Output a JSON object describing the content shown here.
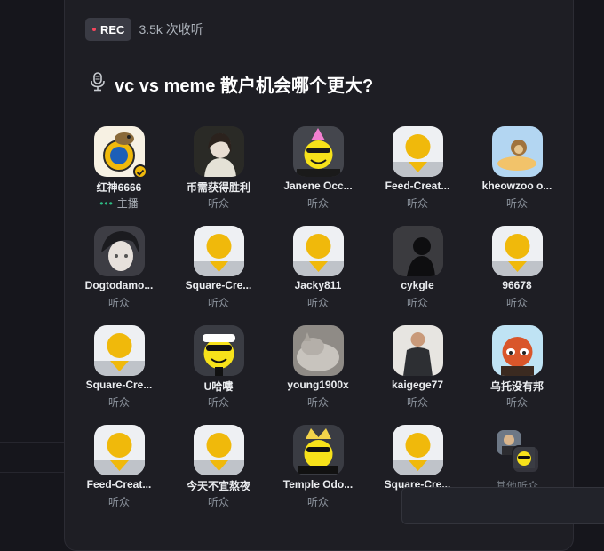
{
  "header": {
    "rec_label": "REC",
    "listen_count": "3.5k 次收听"
  },
  "space": {
    "title": "vc vs meme 散户机会哪个更大?",
    "mic_icon": "microphone-icon"
  },
  "speakers": [
    {
      "name": "红神6666",
      "role": "主播",
      "avatar": "dollar-cat-avatar",
      "host": true,
      "verified": true
    },
    {
      "name": "币需获得胜利",
      "role": "听众",
      "avatar": "photo-girl-avatar"
    },
    {
      "name": "Janene Occ...",
      "role": "听众",
      "avatar": "party-smiley-avatar"
    },
    {
      "name": "Feed-Creat...",
      "role": "听众",
      "avatar": "default-square-avatar"
    },
    {
      "name": "kheowzoo o...",
      "role": "听众",
      "avatar": "cloud-monkey-avatar"
    },
    {
      "name": "Dogtodamo...",
      "role": "听众",
      "avatar": "anime-boy-avatar"
    },
    {
      "name": "Square-Cre...",
      "role": "听众",
      "avatar": "default-square-avatar"
    },
    {
      "name": "Jacky811",
      "role": "听众",
      "avatar": "default-square-avatar"
    },
    {
      "name": "cykgle",
      "role": "听众",
      "avatar": "silhouette-avatar"
    },
    {
      "name": "96678",
      "role": "听众",
      "avatar": "default-square-avatar"
    },
    {
      "name": "Square-Cre...",
      "role": "听众",
      "avatar": "default-square-avatar"
    },
    {
      "name": "U哈嘍",
      "role": "听众",
      "avatar": "cap-smiley-avatar"
    },
    {
      "name": "young1900x",
      "role": "听众",
      "avatar": "cat-photo-avatar"
    },
    {
      "name": "kaigege77",
      "role": "听众",
      "avatar": "man-photo-avatar"
    },
    {
      "name": "乌托没有邦",
      "role": "听众",
      "avatar": "red-panda-avatar"
    },
    {
      "name": "Feed-Creat...",
      "role": "听众",
      "avatar": "default-square-avatar"
    },
    {
      "name": "今天不宜熬夜",
      "role": "听众",
      "avatar": "default-square-avatar"
    },
    {
      "name": "Temple Odo...",
      "role": "听众",
      "avatar": "crown-smiley-avatar"
    },
    {
      "name": "Square-Cre...",
      "role": "听众",
      "avatar": "default-square-avatar"
    }
  ],
  "others": {
    "label": "其他听众"
  },
  "colors": {
    "accent_yellow": "#f0b90b",
    "host_green": "#2ebd85",
    "rec_red": "#f6465d",
    "panel": "#1e1e24",
    "page_bg": "#16161c"
  }
}
